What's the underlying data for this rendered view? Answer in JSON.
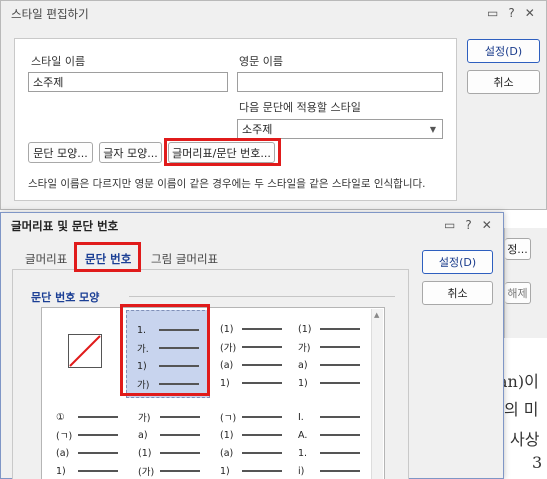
{
  "style_dialog": {
    "title": "스타일 편집하기",
    "title_buttons": [
      "▭",
      "?",
      "✕"
    ],
    "style_name_label": "스타일 이름",
    "style_name_value": "소주제",
    "english_name_label": "영문 이름",
    "english_name_value": "",
    "next_style_label": "다음 문단에 적용할 스타일",
    "next_style_value": "소주제",
    "para_shape_btn": "문단 모양...",
    "char_shape_btn": "글자 모양...",
    "bullet_btn": "글머리표/문단 번호...",
    "note": "스타일 이름은 다르지만 영문 이름이 같은 경우에는 두 스타일을 같은 스타일로 인식합니다.",
    "ok_btn": "설정(D)",
    "cancel_btn": "취소",
    "side_btn_partial": "정...",
    "side_btn_partial2": "해제"
  },
  "bullet_dialog": {
    "title": "글머리표 및 문단 번호",
    "title_buttons": [
      "▭",
      "?",
      "✕"
    ],
    "tabs": [
      "글머리표",
      "문단 번호",
      "그림 글머리표"
    ],
    "active_tab": 1,
    "section_label": "문단 번호 모양",
    "ok_btn": "설정(D)",
    "cancel_btn": "취소",
    "cells": [
      {
        "kind": "none",
        "markers": []
      },
      {
        "kind": "list",
        "markers": [
          "1.",
          "가.",
          "1)",
          "가)"
        ]
      },
      {
        "kind": "list",
        "markers": [
          "(1)",
          "(가)",
          "(a)",
          "1)"
        ]
      },
      {
        "kind": "list",
        "markers": [
          "(1)",
          "가)",
          "a)",
          "1)"
        ]
      },
      {
        "kind": "list",
        "markers": [
          "①",
          "(ㄱ)",
          "(a)",
          "1)"
        ]
      },
      {
        "kind": "list",
        "markers": [
          "가)",
          "a)",
          "(1)",
          "(가)"
        ]
      },
      {
        "kind": "list",
        "markers": [
          "(ㄱ)",
          "(1)",
          "(a)",
          "1)"
        ]
      },
      {
        "kind": "list",
        "markers": [
          "I.",
          "A.",
          "1.",
          "i)"
        ]
      }
    ]
  },
  "document": {
    "lines": [
      "an)이",
      "의 미",
      "사상",
      "3"
    ]
  }
}
